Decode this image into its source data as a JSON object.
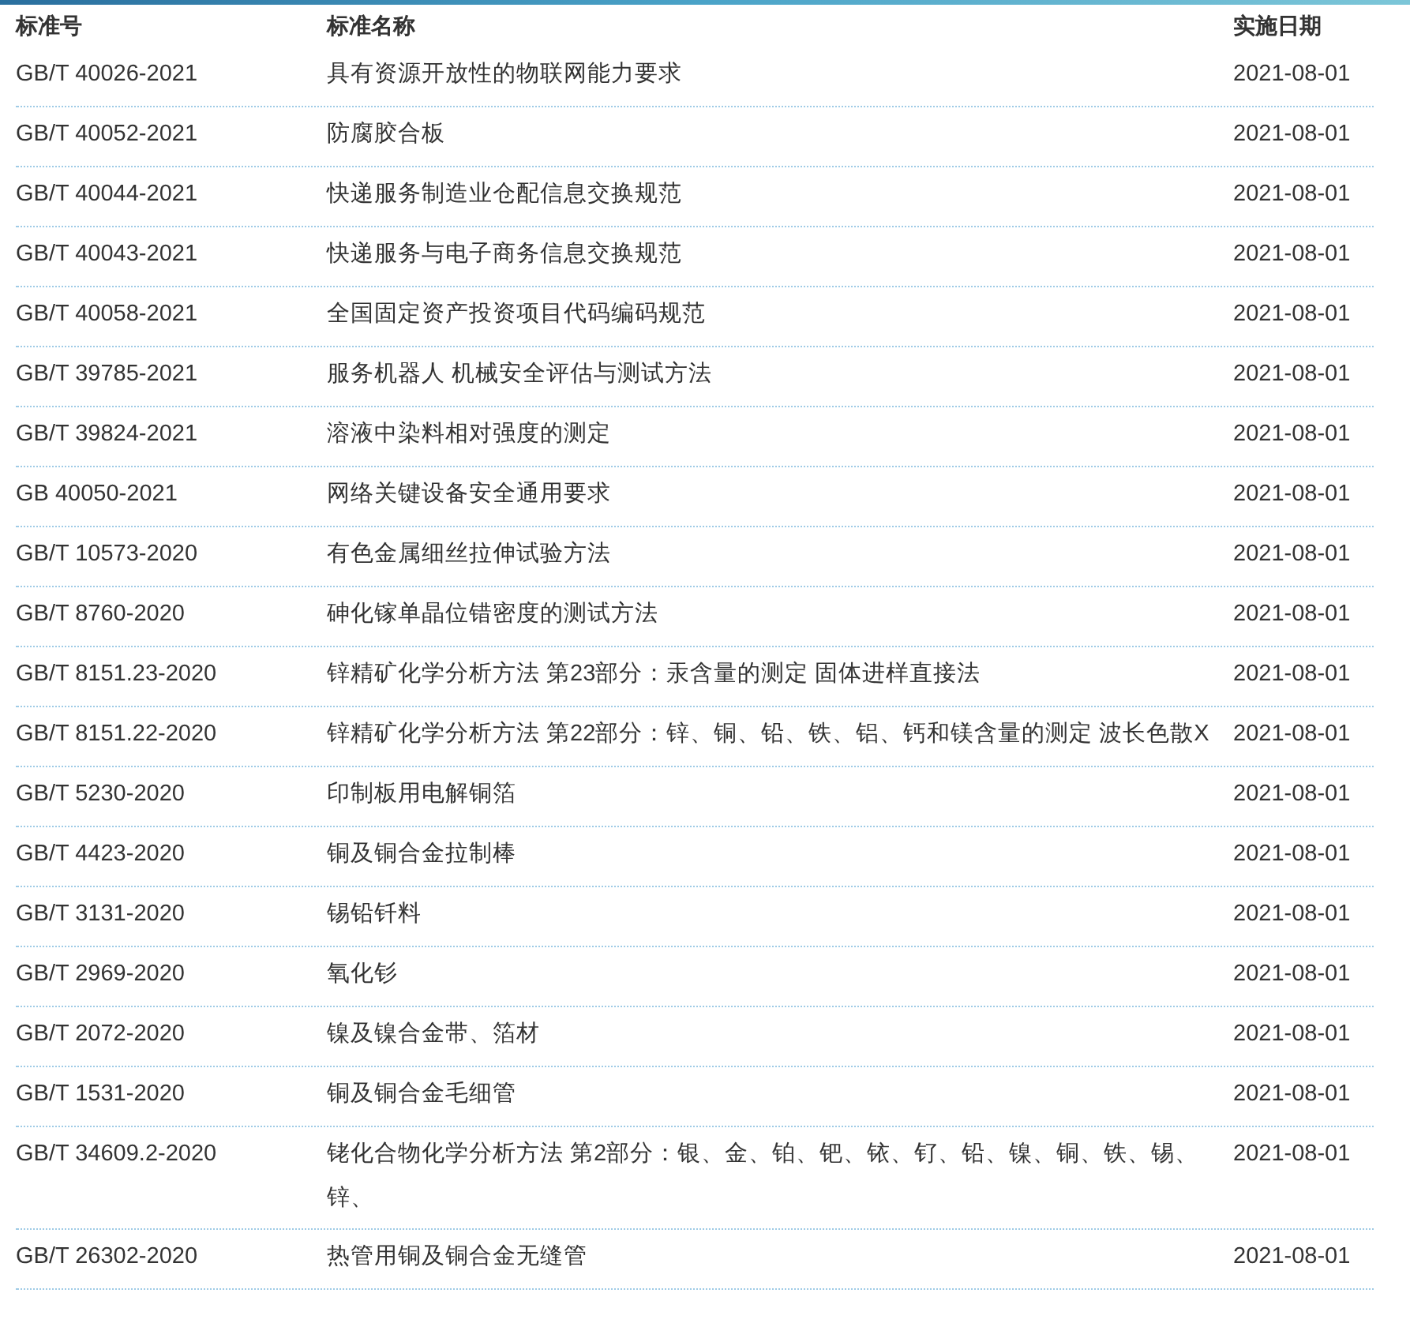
{
  "table": {
    "columns": [
      "标准号",
      "标准名称",
      "实施日期"
    ],
    "rows": [
      {
        "code": "GB/T 40026-2021",
        "name": "具有资源开放性的物联网能力要求",
        "date": "2021-08-01"
      },
      {
        "code": "GB/T 40052-2021",
        "name": "防腐胶合板",
        "date": "2021-08-01"
      },
      {
        "code": "GB/T 40044-2021",
        "name": "快递服务制造业仓配信息交换规范",
        "date": "2021-08-01"
      },
      {
        "code": "GB/T 40043-2021",
        "name": "快递服务与电子商务信息交换规范",
        "date": "2021-08-01"
      },
      {
        "code": "GB/T 40058-2021",
        "name": "全国固定资产投资项目代码编码规范",
        "date": "2021-08-01"
      },
      {
        "code": "GB/T 39785-2021",
        "name": "服务机器人 机械安全评估与测试方法",
        "date": "2021-08-01"
      },
      {
        "code": "GB/T 39824-2021",
        "name": "溶液中染料相对强度的测定",
        "date": "2021-08-01"
      },
      {
        "code": "GB 40050-2021",
        "name": "网络关键设备安全通用要求",
        "date": "2021-08-01"
      },
      {
        "code": "GB/T 10573-2020",
        "name": "有色金属细丝拉伸试验方法",
        "date": "2021-08-01"
      },
      {
        "code": "GB/T 8760-2020",
        "name": "砷化镓单晶位错密度的测试方法",
        "date": "2021-08-01"
      },
      {
        "code": "GB/T 8151.23-2020",
        "name": "锌精矿化学分析方法 第23部分：汞含量的测定 固体进样直接法",
        "date": "2021-08-01"
      },
      {
        "code": "GB/T 8151.22-2020",
        "name": "锌精矿化学分析方法 第22部分：锌、铜、铅、铁、铝、钙和镁含量的测定 波长色散X",
        "date": "2021-08-01"
      },
      {
        "code": "GB/T 5230-2020",
        "name": "印制板用电解铜箔",
        "date": "2021-08-01"
      },
      {
        "code": "GB/T 4423-2020",
        "name": "铜及铜合金拉制棒",
        "date": "2021-08-01"
      },
      {
        "code": "GB/T 3131-2020",
        "name": "锡铅钎料",
        "date": "2021-08-01"
      },
      {
        "code": "GB/T 2969-2020",
        "name": "氧化钐",
        "date": "2021-08-01"
      },
      {
        "code": "GB/T 2072-2020",
        "name": "镍及镍合金带、箔材",
        "date": "2021-08-01"
      },
      {
        "code": "GB/T 1531-2020",
        "name": "铜及铜合金毛细管",
        "date": "2021-08-01"
      },
      {
        "code": "GB/T 34609.2-2020",
        "name": "铑化合物化学分析方法 第2部分：银、金、铂、钯、铱、钌、铅、镍、铜、铁、锡、锌、",
        "date": "2021-08-01"
      },
      {
        "code": "GB/T 26302-2020",
        "name": "热管用铜及铜合金无缝管",
        "date": "2021-08-01"
      }
    ]
  }
}
